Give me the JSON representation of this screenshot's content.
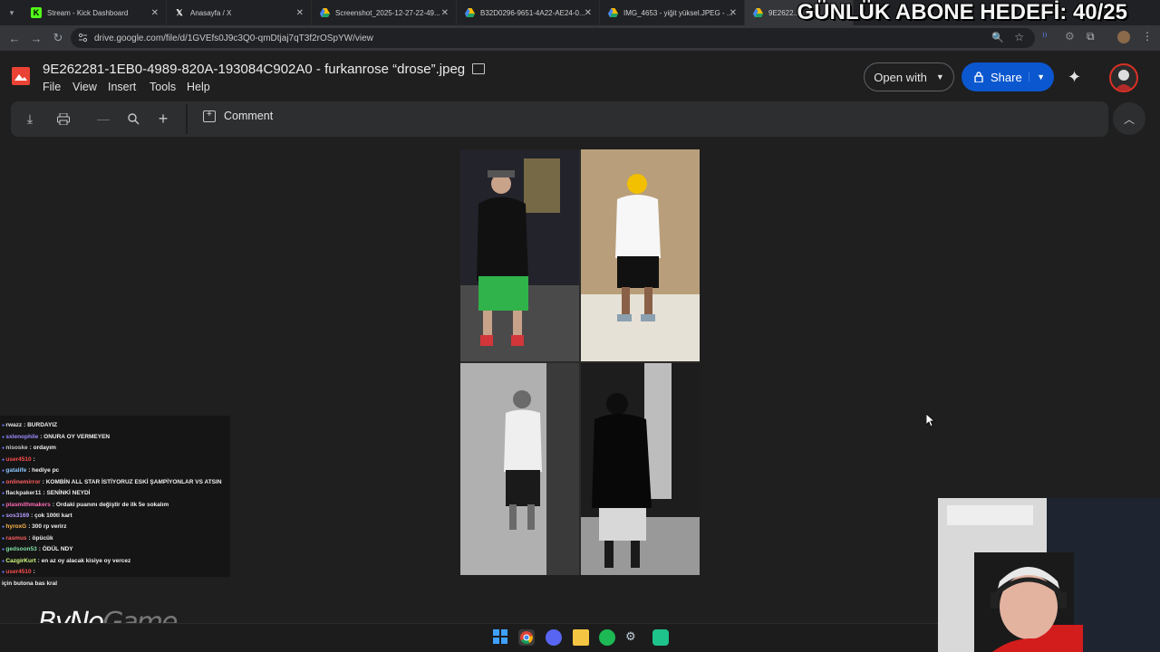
{
  "browser": {
    "tabs": [
      {
        "label": "Stream - Kick Dashboard",
        "favicon": "kick-icon",
        "color": "#53fc18"
      },
      {
        "label": "Anasayfa / X",
        "favicon": "x-icon",
        "color": "#ffffff"
      },
      {
        "label": "Screenshot_2025-12-27-22-49...",
        "favicon": "drive-icon",
        "color": "#fbbc04"
      },
      {
        "label": "B32D0296-9651-4A22-AE24-0...",
        "favicon": "drive-icon",
        "color": "#fbbc04"
      },
      {
        "label": "IMG_4653 - yiğit yüksel.JPEG - ...",
        "favicon": "drive-icon",
        "color": "#fbbc04"
      },
      {
        "label": "9E2622...",
        "favicon": "drive-icon",
        "color": "#fbbc04"
      }
    ],
    "url": "drive.google.com/file/d/1GVEfs0J9c3Q0-qmDtjaj7qT3f2rOSpYW/view"
  },
  "overlay": {
    "goal_text": "GÜNLÜK ABONE HEDEFİ: 40/25"
  },
  "drive": {
    "file_title": "9E262281-1EB0-4989-820A-193084C902A0 - furkanrose “drose”.jpeg",
    "menu": [
      "File",
      "View",
      "Insert",
      "Tools",
      "Help"
    ],
    "open_with_label": "Open with",
    "share_label": "Share",
    "comment_label": "Comment",
    "accent_color": "#0b57d0"
  },
  "chat": {
    "messages": [
      {
        "user": "rwazz",
        "text": "BURDAYIZ",
        "color": "#e8e8e8"
      },
      {
        "user": "sxlenophile",
        "text": "ONURA OY VERMEYEN",
        "color": "#9b8cff"
      },
      {
        "user": "nisoske",
        "text": "ordayım",
        "color": "#c8c8c8"
      },
      {
        "user": "user4510",
        "text": "",
        "color": "#ff4d4d"
      },
      {
        "user": "gatalife",
        "text": "hediye pc",
        "color": "#8cc8ff"
      },
      {
        "user": "onlinemirror",
        "text": "KOMBİN ALL STAR İSTİYORUZ ESKİ ŞAMPİYONLAR VS ATSIN",
        "color": "#ff5f5f"
      },
      {
        "user": "flackpaker11",
        "text": "SENİNKİ NEYDİ",
        "color": "#e8e8e8"
      },
      {
        "user": "plasmithmakers",
        "text": "Ordaki puanını değiştir de ilk 5e sokalım",
        "color": "#ff6bb5"
      },
      {
        "user": "sos3169",
        "text": "çok 100tl kart",
        "color": "#b79cff"
      },
      {
        "user": "hyroxG",
        "text": "300 rp verirz",
        "color": "#ffb84d"
      },
      {
        "user": "rasmus",
        "text": "öpücük",
        "color": "#ff5f5f"
      },
      {
        "user": "gedsoon53",
        "text": "ÖDÜL NDY",
        "color": "#7fe0a6"
      },
      {
        "user": "CazgirKurt",
        "text": "en az oy alacak kisiye oy vercez",
        "color": "#d4ff7f"
      },
      {
        "user": "user4510",
        "text": "",
        "color": "#ff4d4d"
      },
      {
        "user": "",
        "text": "için butona bas kral",
        "color": "#e8e8e8"
      }
    ]
  },
  "brand": {
    "logo_left": "ByNo",
    "logo_right": "Game"
  }
}
